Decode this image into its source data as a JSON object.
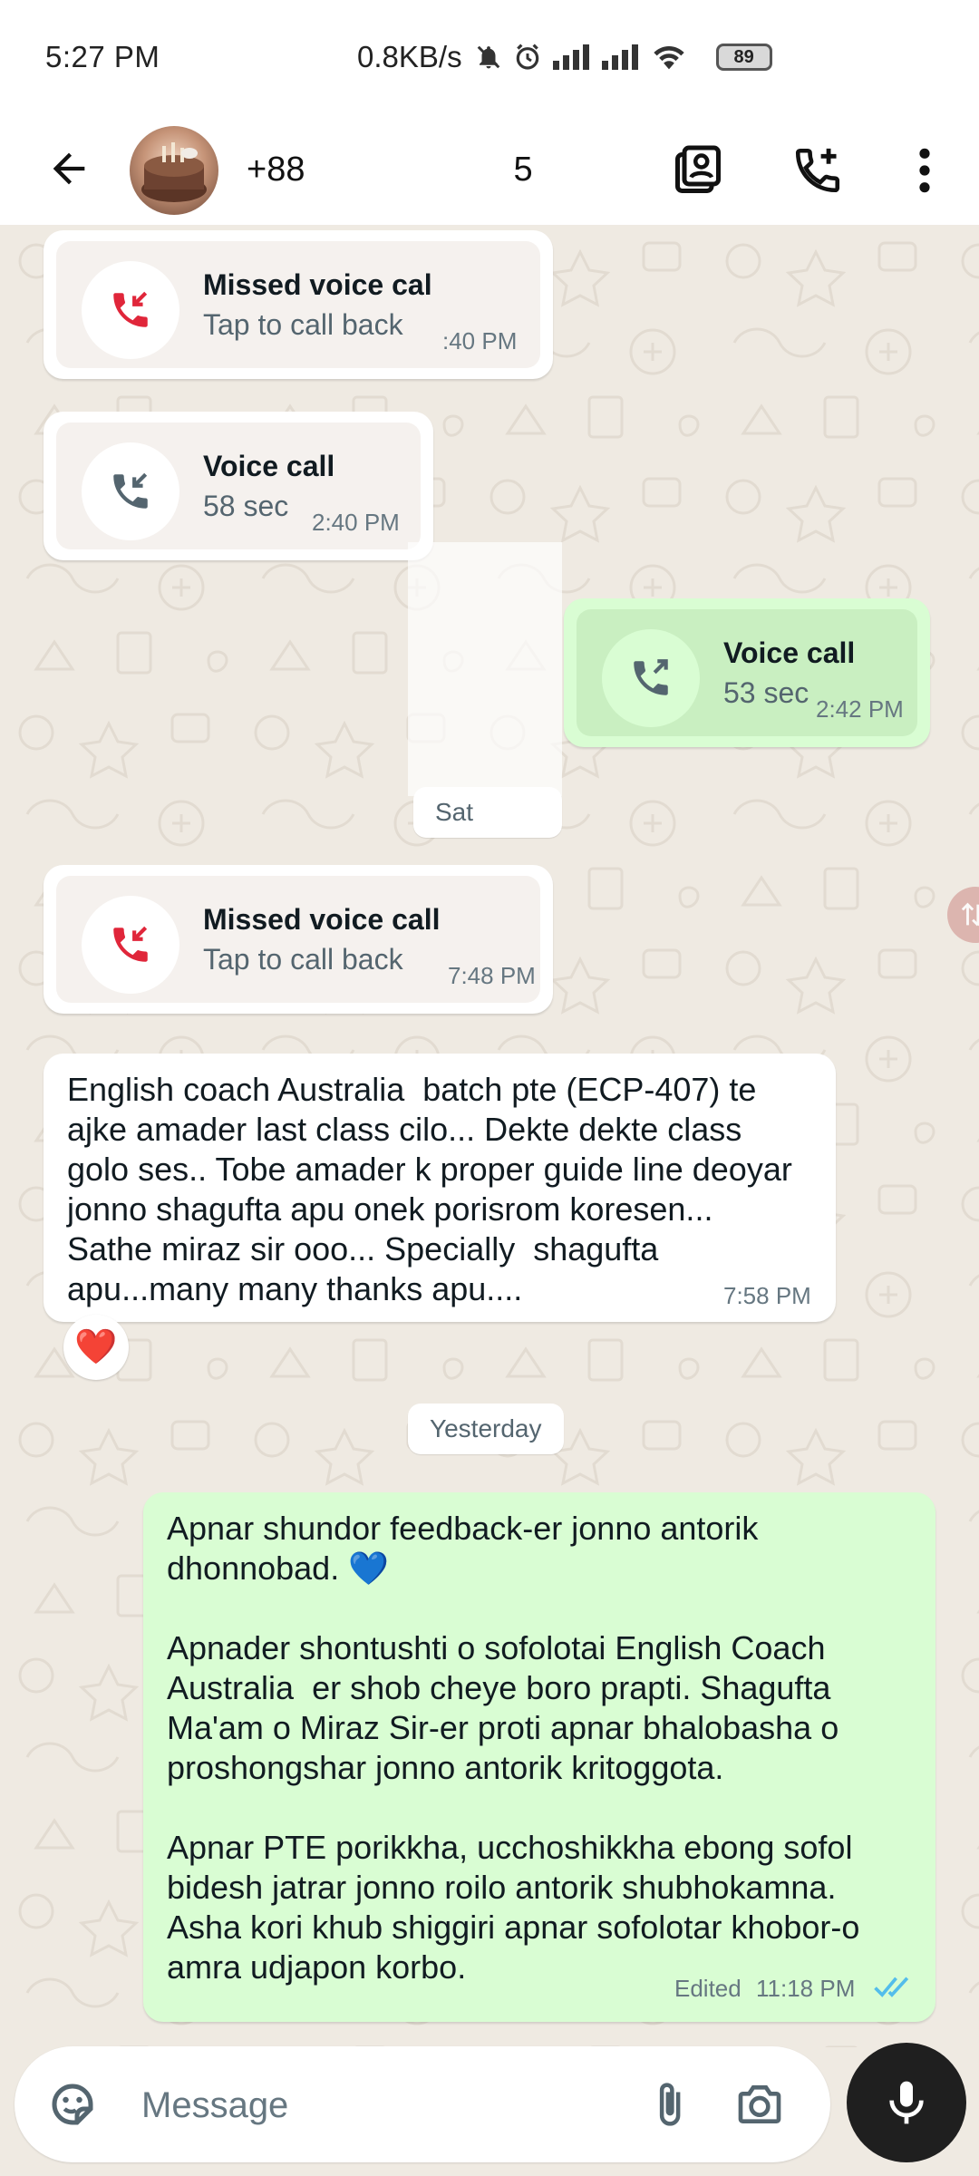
{
  "status_bar": {
    "time": "5:27 PM",
    "network_speed": "0.8KB/s",
    "battery": "89",
    "icons": [
      "mute-icon",
      "alarm-icon",
      "signal-icon",
      "signal-icon",
      "wifi-icon",
      "battery-icon"
    ]
  },
  "header": {
    "contact_name_start": "+88",
    "contact_name_end": "5",
    "icons": [
      "back-arrow-icon",
      "contact-card-icon",
      "add-call-icon",
      "more-vert-icon"
    ]
  },
  "messages": {
    "call1": {
      "title": "Missed voice cal",
      "subtitle": "Tap to call back",
      "time": ":40 PM"
    },
    "call2": {
      "title": "Voice call",
      "subtitle": "58 sec",
      "time": "2:40 PM"
    },
    "call3": {
      "title": "Voice call",
      "subtitle": "53 sec",
      "time": "2:42 PM"
    },
    "date_chip_1": "Sat",
    "call4": {
      "title": "Missed voice call",
      "subtitle": "Tap to call back",
      "time": "7:48 PM"
    },
    "text1": {
      "body": "English coach Australia  batch pte (ECP-407) te\najke amader last class cilo... Dekte dekte class\ngolo ses.. Tobe amader k proper guide line deoyar\njonno shagufta apu onek porisrom koresen...\nSathe miraz sir ooo... Specially  shagufta\napu...many many thanks apu....",
      "time": "7:58 PM",
      "reaction": "❤️"
    },
    "date_chip_2": "Yesterday",
    "text2": {
      "body": "Apnar shundor feedback-er jonno antorik\ndhonnobad. 💙\n\nApnader shontushti o sofolotai English Coach\nAustralia  er shob cheye boro prapti. Shagufta\nMa'am o Miraz Sir-er proti apnar bhalobasha o\nproshongshar jonno antorik kritoggota.\n\nApnar PTE porikkha, ucchoshikkha ebong sofol\nbidesh jatrar jonno roilo antorik shubhokamna.\nAsha kori khub shiggiri apnar sofolotar khobor-o\namra udjapon korbo.",
      "edited_label": "Edited",
      "time": "11:18 PM",
      "status": "read"
    }
  },
  "input": {
    "placeholder": "Message",
    "value": ""
  },
  "colors": {
    "chat_bg": "#efeae2",
    "incoming_bubble": "#ffffff",
    "outgoing_bubble": "#d9fdd3",
    "missed_call_red": "#e0263a",
    "read_tick_blue": "#53bdeb",
    "mic_button": "#1f1f1f"
  }
}
